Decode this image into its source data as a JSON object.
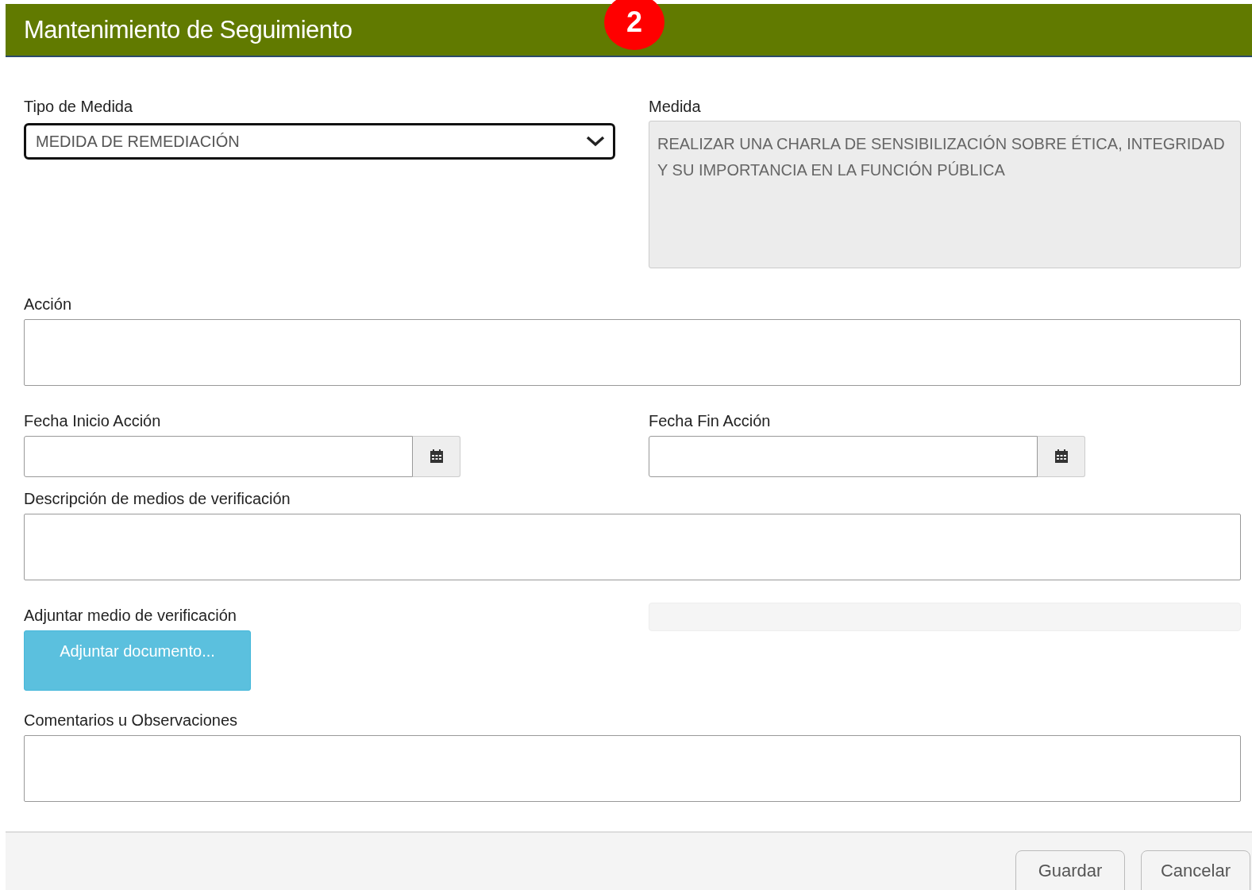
{
  "header": {
    "title": "Mantenimiento de Seguimiento",
    "badge": "2"
  },
  "tipo_medida": {
    "label": "Tipo de Medida",
    "value": "MEDIDA DE REMEDIACIÓN"
  },
  "medida": {
    "label": "Medida",
    "value": "REALIZAR UNA CHARLA DE SENSIBILIZACIÓN SOBRE ÉTICA, INTEGRIDAD Y SU IMPORTANCIA EN LA FUNCIÓN PÚBLICA"
  },
  "accion": {
    "label": "Acción"
  },
  "fecha_inicio": {
    "label": "Fecha Inicio Acción"
  },
  "fecha_fin": {
    "label": "Fecha Fin Acción"
  },
  "descripcion": {
    "label": "Descripción de medios de verificación"
  },
  "adjuntar": {
    "label": "Adjuntar medio de verificación",
    "button": "Adjuntar documento...",
    "progress": {
      "level": 0
    }
  },
  "comentarios": {
    "label": "Comentarios u Observaciones"
  },
  "footer": {
    "buttons": [
      "Guardar",
      "Cancelar"
    ]
  }
}
